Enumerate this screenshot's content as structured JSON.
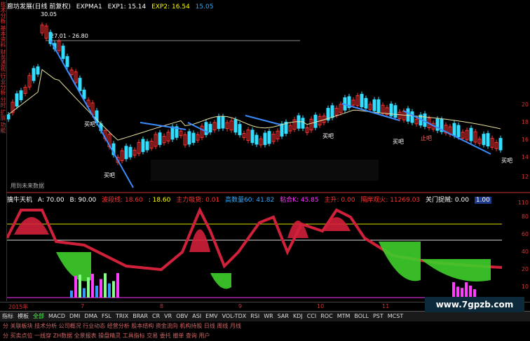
{
  "main_header": {
    "title": "廊坊发展(日线 前复权)",
    "indicator": "EXPMA1",
    "exp1": "EXP1: 15.14",
    "exp2": "EXP2: 16.54",
    "exp3": "15.05"
  },
  "price_labels": {
    "high": "30.05",
    "range": "27.01 - 26.80"
  },
  "main_axis": [
    "20",
    "18",
    "16",
    "14",
    "12"
  ],
  "signals": {
    "buy": "买吧",
    "sell": "止吧",
    "future_data": "用到未来数据"
  },
  "indicator_header": {
    "name": "擒牛天机",
    "a": "A: 70.00",
    "b": "B: 90.00",
    "bo_duan": "波段线: 18.60",
    "value2": ": 18.60",
    "zhu_li": "主力吸货: 0.01",
    "gao_shu": "高数量60: 41.82",
    "zhan_he": "粘合K: 45.85",
    "zhu_sheng": "主升: 0.00",
    "ge_an": "隔岸观火: 11269.03",
    "guan_men": "关门捉贼: 0.00",
    "badge": "1.00"
  },
  "indicator_axis": [
    "110",
    "80",
    "60",
    "40",
    "20",
    "10"
  ],
  "side_labels": [
    "技术分析",
    "基本资料",
    "财务透视",
    "行业分析",
    "分时",
    "扩展",
    "功能"
  ],
  "dates": [
    "2015年",
    "7",
    "8",
    "9",
    "10",
    "11"
  ],
  "tabs": [
    "指标",
    "模板",
    "全部",
    "MACD",
    "DMI",
    "DMA",
    "FSL",
    "TRIX",
    "BRAR",
    "CR",
    "VR",
    "OBV",
    "ASI",
    "EMV",
    "VOL-TDX",
    "RSI",
    "WR",
    "SAR",
    "KDJ",
    "CCI",
    "ROC",
    "MTM",
    "BOLL",
    "PST",
    "MCST"
  ],
  "status_rows": [
    "分 关联板块 技术分析 公司概况 行业动态 经营分析 股本结构 资金流向 机构持股 日线 周线 月线",
    "分 买卖点位 一线穿 ZH数据 全景报表 操盘精灵 工具指标 交易 委托 撤单 查询 用户"
  ],
  "watermark": "www.7gpzb.com",
  "colors": {
    "up": "#ff3333",
    "down": "#33ddff",
    "ma": "#e8e0a0",
    "trend": "#3a8cff",
    "indicator_red": "#d0203a",
    "indicator_green": "#3ecf2a",
    "magenta": "#ff3cff"
  }
}
